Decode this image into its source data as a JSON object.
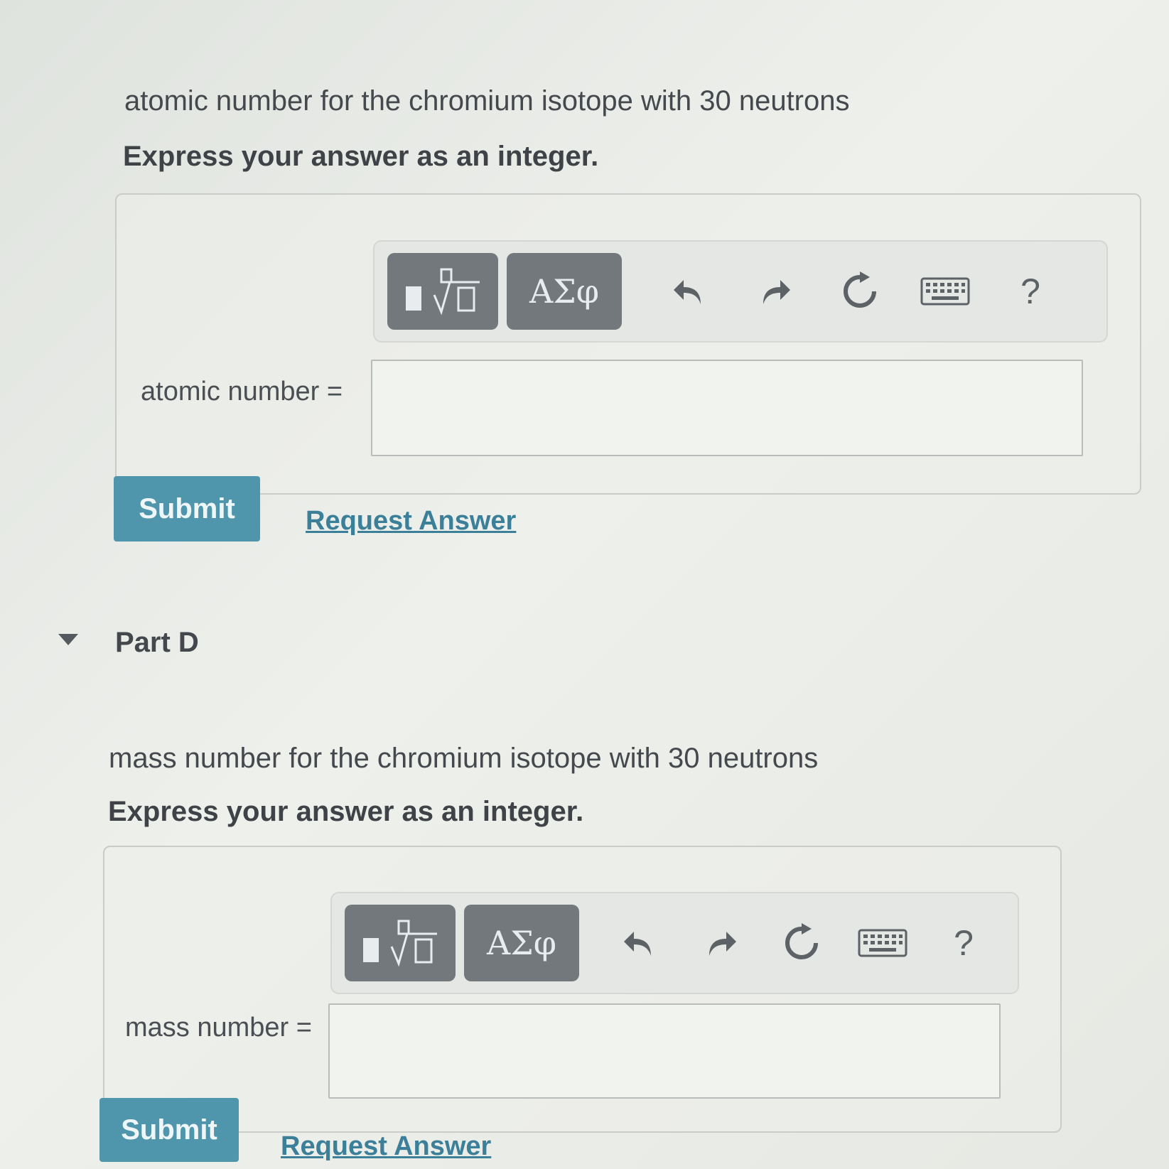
{
  "part_c": {
    "question": "atomic number for the chromium isotope with 30 neutrons",
    "instruction": "Express your answer as an integer.",
    "toolbar": {
      "templates_icon": "fraction-sqrt-template-icon",
      "greek_label": "ΑΣφ",
      "undo_icon": "undo-icon",
      "redo_icon": "redo-icon",
      "reset_icon": "reset-icon",
      "keyboard_icon": "keyboard-icon",
      "help_label": "?"
    },
    "field_label": "atomic number =",
    "input_value": "",
    "submit_label": "Submit",
    "request_label": "Request Answer"
  },
  "part_d": {
    "title": "Part D",
    "question": "mass number for the chromium isotope with 30 neutrons",
    "instruction": "Express your answer as an integer.",
    "toolbar": {
      "templates_icon": "fraction-sqrt-template-icon",
      "greek_label": "ΑΣφ",
      "undo_icon": "undo-icon",
      "redo_icon": "redo-icon",
      "reset_icon": "reset-icon",
      "keyboard_icon": "keyboard-icon",
      "help_label": "?"
    },
    "field_label": "mass number =",
    "input_value": "",
    "submit_label": "Submit",
    "request_label": "Request Answer"
  },
  "colors": {
    "submit_bg": "#4f96ad",
    "link": "#3b7f99",
    "tool_dark": "#72787b"
  }
}
